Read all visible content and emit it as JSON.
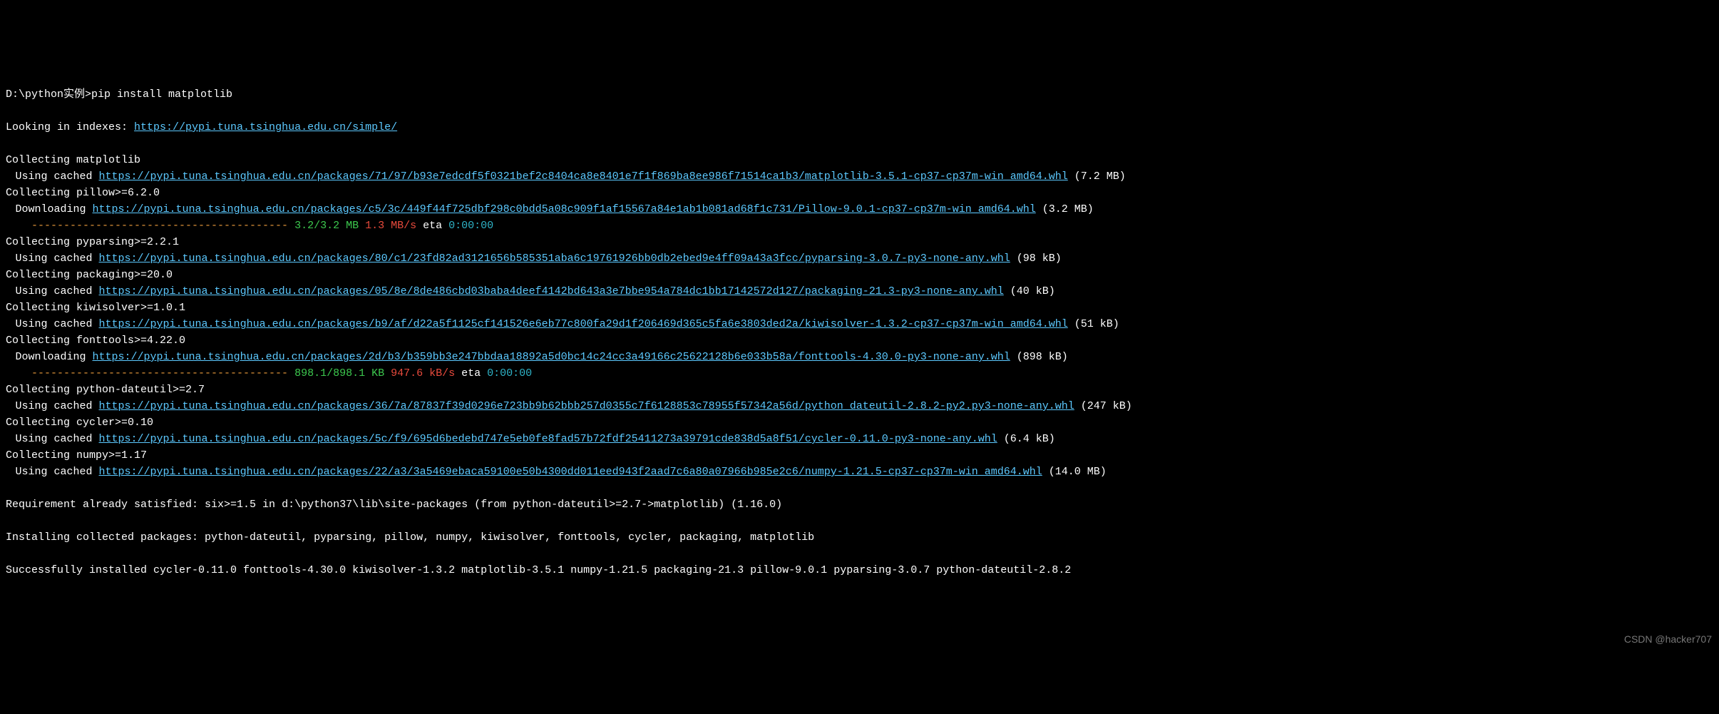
{
  "prompt": {
    "path": "D:\\python实例>",
    "command": "pip install matplotlib"
  },
  "index_line": {
    "prefix": "Looking in indexes: ",
    "url": "https://pypi.tuna.tsinghua.edu.cn/simple/"
  },
  "packages": [
    {
      "collect": "Collecting matplotlib",
      "action": "Using cached",
      "url": "https://pypi.tuna.tsinghua.edu.cn/packages/71/97/b93e7edcdf5f0321bef2c8404ca8e8401e7f1f869ba8ee986f71514ca1b3/matplotlib-3.5.1-cp37-cp37m-win_amd64.whl",
      "size": " (7.2 MB)"
    },
    {
      "collect": "Collecting pillow>=6.2.0",
      "action": "Downloading",
      "url": "https://pypi.tuna.tsinghua.edu.cn/packages/c5/3c/449f44f725dbf298c0bdd5a08c909f1af15567a84e1ab1b081ad68f1c731/Pillow-9.0.1-cp37-cp37m-win_amd64.whl",
      "size": " (3.2 MB)",
      "progress": {
        "bar": "---------------------------------------- ",
        "done": "3.2/3.2 MB",
        "speed": " 1.3 MB/s",
        "eta_lbl": " eta ",
        "eta": "0:00:00"
      }
    },
    {
      "collect": "Collecting pyparsing>=2.2.1",
      "action": "Using cached",
      "url": "https://pypi.tuna.tsinghua.edu.cn/packages/80/c1/23fd82ad3121656b585351aba6c19761926bb0db2ebed9e4ff09a43a3fcc/pyparsing-3.0.7-py3-none-any.whl",
      "size": " (98 kB)"
    },
    {
      "collect": "Collecting packaging>=20.0",
      "action": "Using cached",
      "url": "https://pypi.tuna.tsinghua.edu.cn/packages/05/8e/8de486cbd03baba4deef4142bd643a3e7bbe954a784dc1bb17142572d127/packaging-21.3-py3-none-any.whl",
      "size": " (40 kB)"
    },
    {
      "collect": "Collecting kiwisolver>=1.0.1",
      "action": "Using cached",
      "url": "https://pypi.tuna.tsinghua.edu.cn/packages/b9/af/d22a5f1125cf141526e6eb77c800fa29d1f206469d365c5fa6e3803ded2a/kiwisolver-1.3.2-cp37-cp37m-win_amd64.whl",
      "size": " (51 kB)"
    },
    {
      "collect": "Collecting fonttools>=4.22.0",
      "action": "Downloading",
      "url": "https://pypi.tuna.tsinghua.edu.cn/packages/2d/b3/b359bb3e247bbdaa18892a5d0bc14c24cc3a49166c25622128b6e033b58a/fonttools-4.30.0-py3-none-any.whl",
      "size": " (898 kB)",
      "progress": {
        "bar": "---------------------------------------- ",
        "done": "898.1/898.1 KB",
        "speed": " 947.6 kB/s",
        "eta_lbl": " eta ",
        "eta": "0:00:00"
      }
    },
    {
      "collect": "Collecting python-dateutil>=2.7",
      "action": "Using cached",
      "url": "https://pypi.tuna.tsinghua.edu.cn/packages/36/7a/87837f39d0296e723bb9b62bbb257d0355c7f6128853c78955f57342a56d/python_dateutil-2.8.2-py2.py3-none-any.whl",
      "size": " (247 kB)"
    },
    {
      "collect": "Collecting cycler>=0.10",
      "action": "Using cached",
      "url": "https://pypi.tuna.tsinghua.edu.cn/packages/5c/f9/695d6bedebd747e5eb0fe8fad57b72fdf25411273a39791cde838d5a8f51/cycler-0.11.0-py3-none-any.whl",
      "size": " (6.4 kB)"
    },
    {
      "collect": "Collecting numpy>=1.17",
      "action": "Using cached",
      "url": "https://pypi.tuna.tsinghua.edu.cn/packages/22/a3/3a5469ebaca59100e50b4300dd011eed943f2aad7c6a80a07966b985e2c6/numpy-1.21.5-cp37-cp37m-win_amd64.whl",
      "size": " (14.0 MB)"
    }
  ],
  "requirement": "Requirement already satisfied: six>=1.5 in d:\\python37\\lib\\site-packages (from python-dateutil>=2.7->matplotlib) (1.16.0)",
  "installing": "Installing collected packages: python-dateutil, pyparsing, pillow, numpy, kiwisolver, fonttools, cycler, packaging, matplotlib",
  "success": "Successfully installed cycler-0.11.0 fonttools-4.30.0 kiwisolver-1.3.2 matplotlib-3.5.1 numpy-1.21.5 packaging-21.3 pillow-9.0.1 pyparsing-3.0.7 python-dateutil-2.8.2",
  "watermark": "CSDN @hacker707"
}
